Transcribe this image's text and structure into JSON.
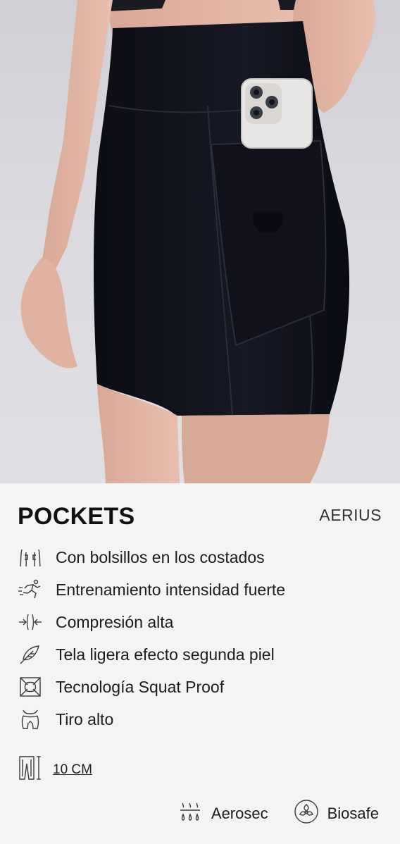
{
  "product": {
    "name": "POCKETS",
    "brand": "AERIUS"
  },
  "features": [
    {
      "icon": "side-pockets-icon",
      "label": "Con bolsillos en los costados"
    },
    {
      "icon": "running-person-icon",
      "label": "Entrenamiento intensidad fuerte"
    },
    {
      "icon": "compression-arrows-icon",
      "label": "Compresión alta"
    },
    {
      "icon": "feather-icon",
      "label": "Tela ligera efecto segunda piel"
    },
    {
      "icon": "squat-proof-icon",
      "label": "Tecnología Squat Proof"
    },
    {
      "icon": "high-waist-icon",
      "label": "Tiro alto"
    }
  ],
  "size": {
    "icon": "inseam-length-icon",
    "label": "10 CM"
  },
  "badges": [
    {
      "icon": "aerosec-icon",
      "label": "Aerosec"
    },
    {
      "icon": "biosafe-icon",
      "label": "Biosafe"
    }
  ]
}
